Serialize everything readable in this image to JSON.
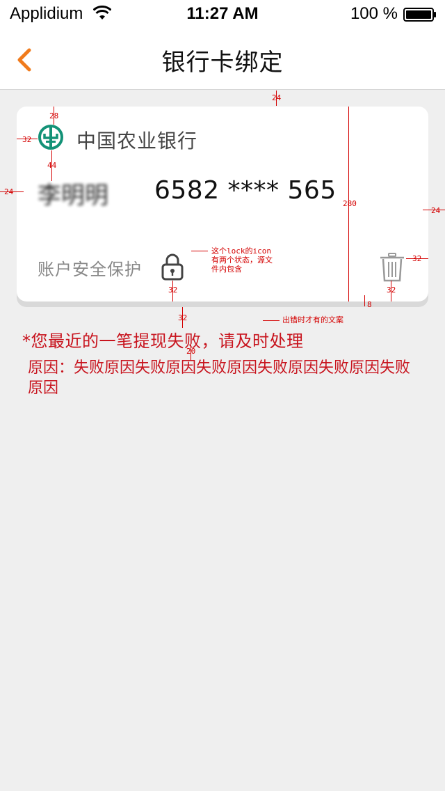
{
  "status_bar": {
    "carrier": "Applidium",
    "time": "11:27 AM",
    "battery": "100 %"
  },
  "nav": {
    "title": "银行卡绑定",
    "back_icon": "chevron-left-icon",
    "accent": "#f07b1c"
  },
  "card": {
    "bank_name": "中国农业银行",
    "bank_logo_color": "#139277",
    "holder_name": "李明明",
    "card_number": "6582 **** 565",
    "security_label": "账户安全保护",
    "lock_icon": "lock-icon",
    "trash_icon": "trash-icon"
  },
  "annotations": {
    "top_gap": "24",
    "logo_top": "28",
    "logo_left": "32",
    "logo_to_name": "44",
    "card_left": "24",
    "card_height": "280",
    "card_right": "24",
    "lock_note": "这个lock的icon有两个状态，源文件内包含",
    "lock_bottom": "32",
    "trash_right": "32",
    "trash_bottom": "32",
    "shadow": "8",
    "error_gap": "32",
    "error_note": "出错时才有的文案",
    "line_gap": "20"
  },
  "error": {
    "message": "*您最近的一笔提现失败，请及时处理",
    "reason": "原因：失败原因失败原因失败原因失败原因失败原因失败原因",
    "color": "#c8141e"
  }
}
